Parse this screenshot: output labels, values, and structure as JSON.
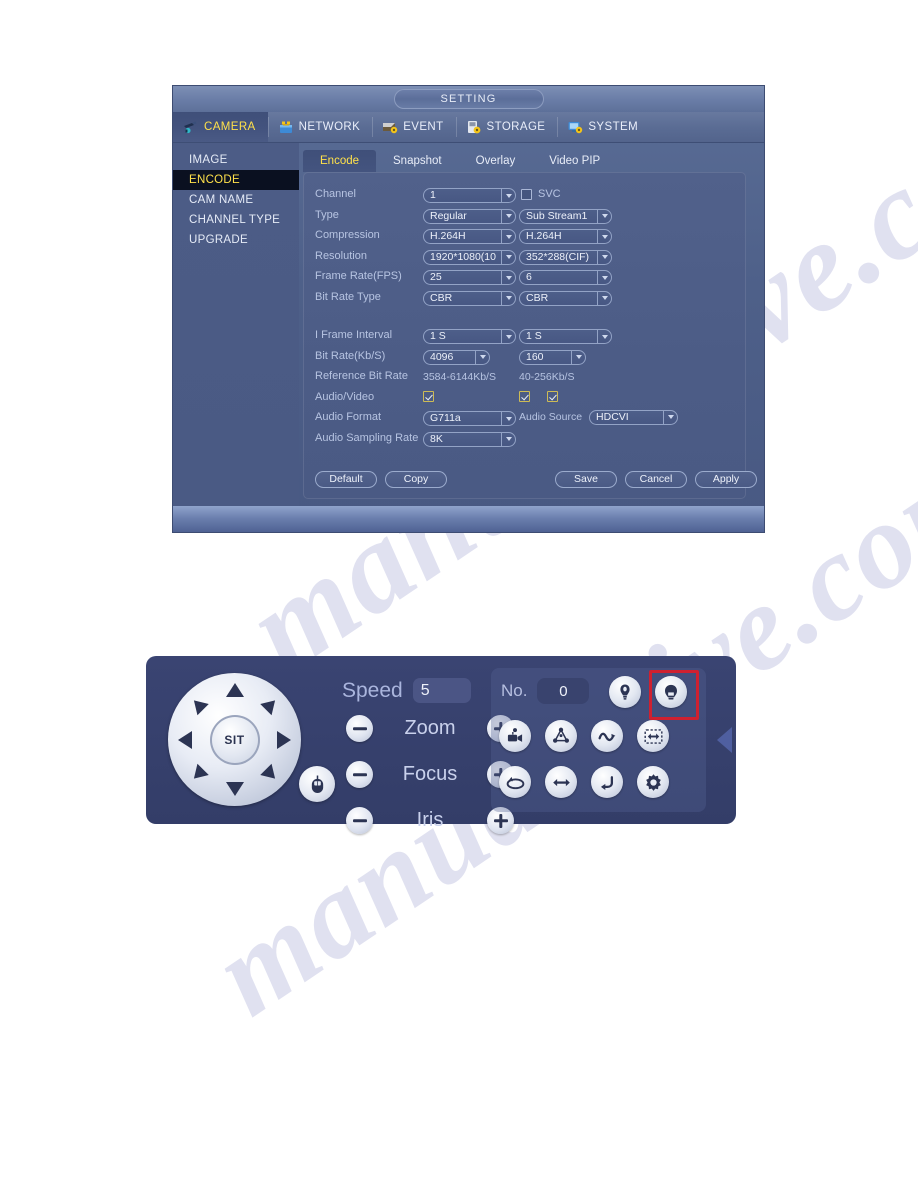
{
  "watermark": {
    "line1": "manualshive.com",
    "line2": "manualshive.com"
  },
  "setting_dialog": {
    "title": "SETTING",
    "nav_tabs": [
      {
        "label": "CAMERA",
        "icon": "camera-icon",
        "active": true
      },
      {
        "label": "NETWORK",
        "icon": "network-icon",
        "active": false
      },
      {
        "label": "EVENT",
        "icon": "event-icon",
        "active": false
      },
      {
        "label": "STORAGE",
        "icon": "storage-icon",
        "active": false
      },
      {
        "label": "SYSTEM",
        "icon": "system-icon",
        "active": false
      }
    ],
    "side_menu": [
      {
        "label": "IMAGE",
        "active": false
      },
      {
        "label": "ENCODE",
        "active": true
      },
      {
        "label": "CAM NAME",
        "active": false
      },
      {
        "label": "CHANNEL TYPE",
        "active": false
      },
      {
        "label": "UPGRADE",
        "active": false
      }
    ],
    "sub_tabs": [
      {
        "label": "Encode",
        "active": true
      },
      {
        "label": "Snapshot",
        "active": false
      },
      {
        "label": "Overlay",
        "active": false
      },
      {
        "label": "Video PIP",
        "active": false
      }
    ],
    "form": {
      "svc": {
        "label": "SVC",
        "checked": false
      },
      "rows": [
        {
          "label": "Channel",
          "main": "1",
          "sub": null
        },
        {
          "label": "Type",
          "main": "Regular",
          "sub": "Sub Stream1"
        },
        {
          "label": "Compression",
          "main": "H.264H",
          "sub": "H.264H"
        },
        {
          "label": "Resolution",
          "main": "1920*1080(10",
          "sub": "352*288(CIF)"
        },
        {
          "label": "Frame Rate(FPS)",
          "main": "25",
          "sub": "6"
        },
        {
          "label": "Bit Rate Type",
          "main": "CBR",
          "sub": "CBR"
        }
      ],
      "rows2": [
        {
          "label": "I Frame Interval",
          "main": "1 S",
          "sub": "1 S"
        },
        {
          "label": "Bit Rate(Kb/S)",
          "main": "4096",
          "sub": "160"
        }
      ],
      "reference": {
        "label": "Reference Bit Rate",
        "main": "3584-6144Kb/S",
        "sub": "40-256Kb/S"
      },
      "audio_video": {
        "label": "Audio/Video",
        "main_checked": true,
        "sub_checked_1": true,
        "sub_checked_2": true
      },
      "audio_format": {
        "label": "Audio Format",
        "value": "G711a"
      },
      "audio_source": {
        "label": "Audio Source",
        "value": "HDCVI"
      },
      "audio_sampling_rate": {
        "label": "Audio Sampling Rate",
        "value": "8K"
      }
    },
    "buttons": {
      "default": "Default",
      "copy": "Copy",
      "save": "Save",
      "cancel": "Cancel",
      "apply": "Apply"
    },
    "colors": {
      "accent_yellow": "#ffe14a",
      "panel_blue": "#4a5a84",
      "label_blue": "#b7c4e2"
    }
  },
  "ptz_panel": {
    "dpad": {
      "center_label": "SIT"
    },
    "speed": {
      "label": "Speed",
      "value": "5"
    },
    "controls": [
      {
        "label": "Zoom",
        "minus": "-",
        "plus": "+"
      },
      {
        "label": "Focus",
        "minus": "-",
        "plus": "+"
      },
      {
        "label": "Iris",
        "minus": "-",
        "plus": "+"
      }
    ],
    "no_field": {
      "label": "No.",
      "value": "0"
    },
    "icons_row0": [
      {
        "name": "preset-icon",
        "highlighted": false
      },
      {
        "name": "tour-icon",
        "highlighted": true
      }
    ],
    "icons_row1": [
      {
        "name": "pattern-camera-icon",
        "highlighted": false
      },
      {
        "name": "autoscan-icon",
        "highlighted": false
      },
      {
        "name": "autopan-wave-icon",
        "highlighted": false
      },
      {
        "name": "flip-border-icon",
        "highlighted": false
      }
    ],
    "icons_row2": [
      {
        "name": "rotate-loop-icon",
        "highlighted": false
      },
      {
        "name": "pan-arrows-icon",
        "highlighted": false
      },
      {
        "name": "reset-return-icon",
        "highlighted": false
      },
      {
        "name": "aux-config-gear-icon",
        "highlighted": false
      }
    ],
    "collapse": {
      "name": "collapse-left-arrow-icon"
    },
    "mouse_button": {
      "name": "mouse-icon"
    },
    "colors": {
      "highlight_red": "#cf2030",
      "panel_navy": "#3a4472"
    }
  }
}
